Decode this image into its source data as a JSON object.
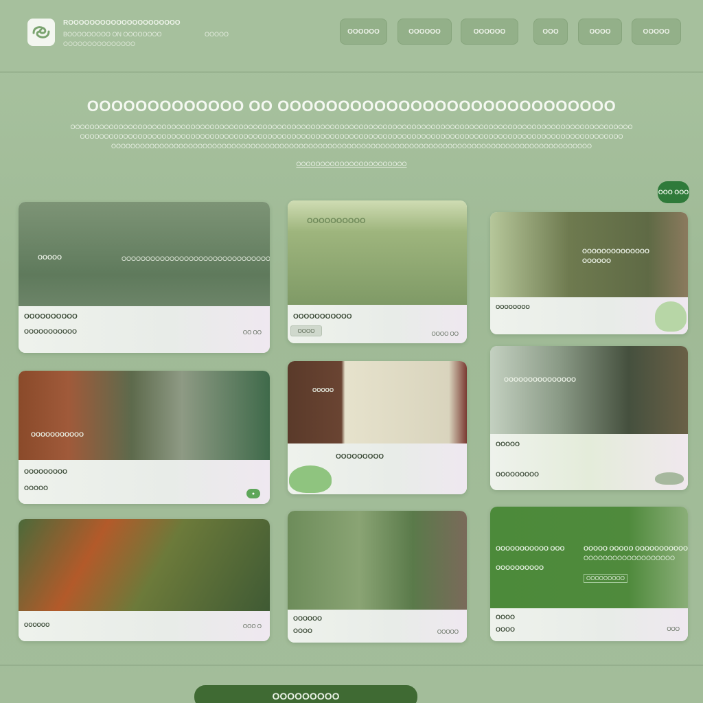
{
  "header": {
    "brand_name": "ROOOOOOOOOOOOOOOOOOOOO",
    "brand_sub": "BOOOOOOOOO ON OOOOOOOO",
    "brand_sub_right": "OOOOO",
    "brand_sub2": "OOOOOOOOOOOOOOO",
    "nav": [
      "OOOOOO",
      "OOOOOO",
      "OOOOOO",
      "OOO",
      "OOOO",
      "OOOOO"
    ]
  },
  "hero": {
    "title": "OOOOOOOOOOOOO OO OOOOOOOOOOOOOOOOOOOOOOOOOOOO",
    "text": "OOOOOOOOOOOOOOOOOOOOOOOOOOOOOOOOOOOOOOOOOOOOOOOOOOOOOOOOOOOOOOOOOOOOOOOOOOOOOOOOOOOOOOOOOOOOOOOOOOOOOOOOOOOOOOOOOOOOO OOOOOOOOOOOOOOOOOOOOOOOOOOOOOOOOOOOOOOOOOOOOOOOOOOOOOOOOOOOOOOOOOOOOOOOOOOOOOOOOOOOOOOOOOOOOOOOOOOOOOOOOOOOOOOOOO OOOOOOOOOOOOOOOOOOOOOOOOOOOOOOOOOOOOOOOOOOOOOOOOOOOOOOOOOOOOOOOOOOOOOOOOOOOOOOOOOOOOOOOOOOOOOOOOOOOO",
    "link": "OOOOOOOOOOOOOOOOOOOOOOO",
    "pill": "OOO OOO"
  },
  "cards": [
    {
      "img_label": "OOOOO",
      "img_label2": "OOOOOOOOOOOOOOOOOOOOOOOOOOOOOOOOO",
      "title": "OOOOOOOOOO",
      "subtitle": "OOOOOOOOOOO",
      "meta": "OO OO",
      "img_color": "#6f8a68"
    },
    {
      "img_label": "OOOOOOOOOO",
      "img_label2": "",
      "title": "OOOOOOOOOOO",
      "subtitle": "",
      "meta": "OOOO OO",
      "chip": "OOOO",
      "img_color": "#8fae77"
    },
    {
      "img_label": "OOOOOOOOOOOOOO",
      "img_label2": "OOOOOO",
      "title": "OOOOOOOO",
      "subtitle": "",
      "meta": "",
      "img_color": "#6e7a4f"
    },
    {
      "img_label": "OOOOOOOOOOO",
      "img_label2": "",
      "title": "OOOOOOOOO",
      "subtitle": "OOOOO",
      "meta": "",
      "img_color": "#7b6048"
    },
    {
      "img_label": "OOOOO",
      "img_label2": "",
      "title": "OOOOOOOOO",
      "subtitle": "",
      "meta": "",
      "img_color": "#b9ab8c"
    },
    {
      "img_label": "OOOOOOOOOOOOOOO",
      "img_label2": "",
      "title": "OOOOO",
      "subtitle": "OOOOOOOOO",
      "meta": "",
      "img_color": "#8a9a86"
    },
    {
      "img_label": "",
      "img_label2": "",
      "title": "OOOOOO",
      "subtitle": "",
      "meta": "OOO O",
      "img_color": "#4b6a3a"
    },
    {
      "img_label": "",
      "img_label2": "",
      "title": "OOOOOO",
      "subtitle": "OOOO",
      "meta": "OOOOO",
      "img_color": "#6d8c5a"
    },
    {
      "img_label": "OOOOOOOOOOO OOO",
      "img_label2": "OOOOOOOOOO",
      "panel_right": "OOOOO OOOOO OOOOOOOOOOO",
      "panel_right2": "OOOOOOOOOOOOOOOOOOO",
      "panel_right3": "OOOOOOOOO",
      "title": "OOOO",
      "subtitle": "OOOO",
      "meta": "OOO",
      "img_color": "#4c8a3a"
    }
  ],
  "cta": {
    "label": "OOOOOOOOO"
  },
  "colors": {
    "accent": "#3f6a33",
    "pill": "#2f7a3a",
    "background": "#a6c09d"
  }
}
